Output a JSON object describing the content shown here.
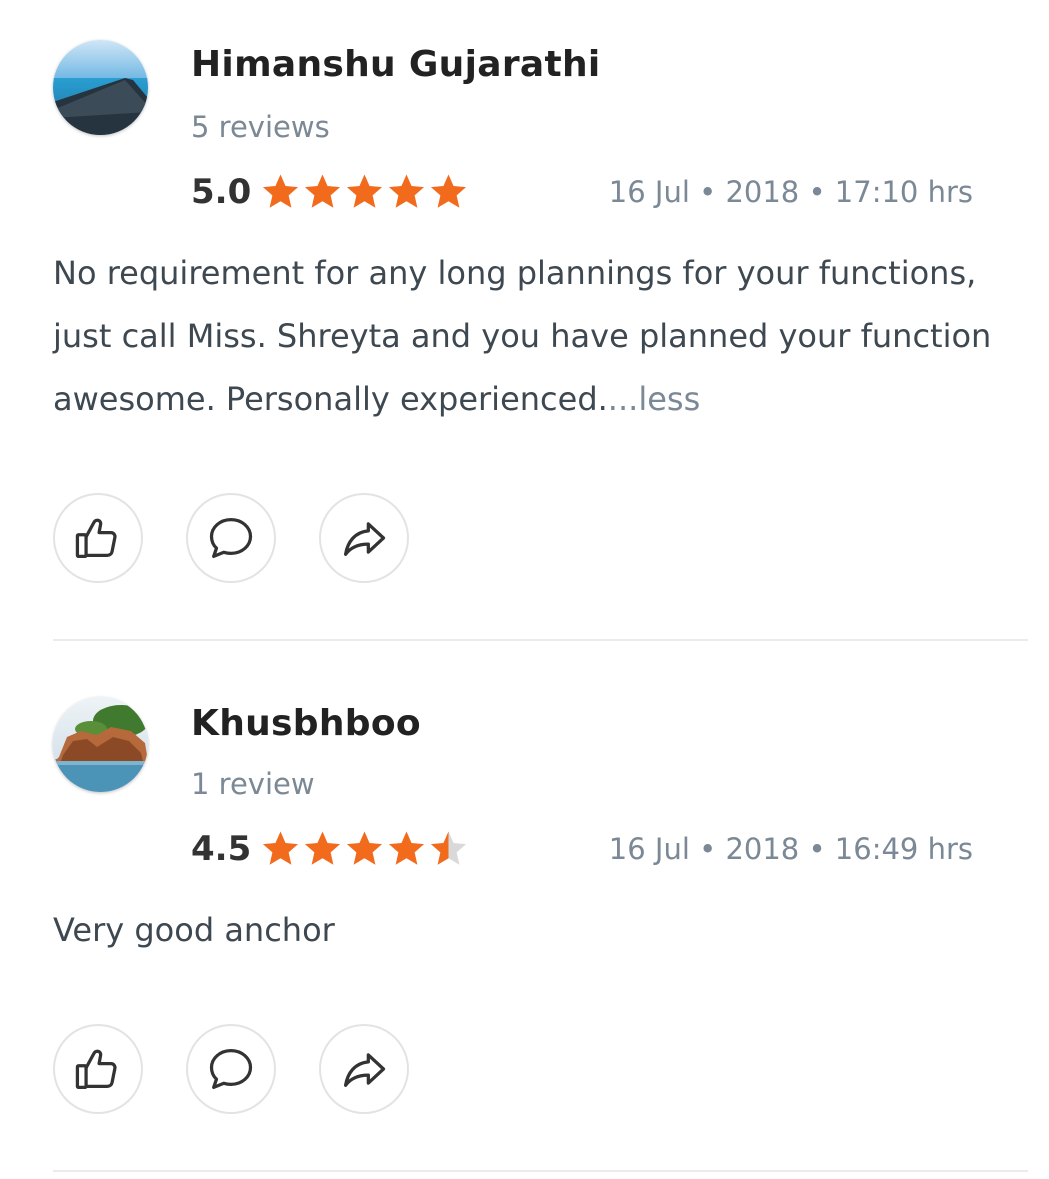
{
  "reviews": [
    {
      "name": "Himanshu Gujarathi",
      "review_count": "5 reviews",
      "score": "5.0",
      "rating": 5.0,
      "date": "16 Jul • 2018 • 17:10 hrs",
      "text": "No requirement for any long plannings for your functions, just call Miss. Shreyta and you have planned your function awesome. Personally experienced.",
      "more_label": "...less",
      "avatar_icon": "pier-sea-avatar"
    },
    {
      "name": "Khusbhboo",
      "review_count": "1 review",
      "score": "4.5",
      "rating": 4.5,
      "date": "16 Jul • 2018 • 16:49 hrs",
      "text": "Very good anchor",
      "avatar_icon": "rocky-island-avatar"
    }
  ],
  "icons": {
    "like": "thumbs-up-icon",
    "comment": "comment-bubble-icon",
    "share": "share-arrow-icon",
    "star": "star-icon"
  },
  "colors": {
    "star_filled": "#f26b1d",
    "star_empty": "#d9d9d9",
    "muted_text": "#7b8895",
    "body_text": "#3e4851"
  }
}
